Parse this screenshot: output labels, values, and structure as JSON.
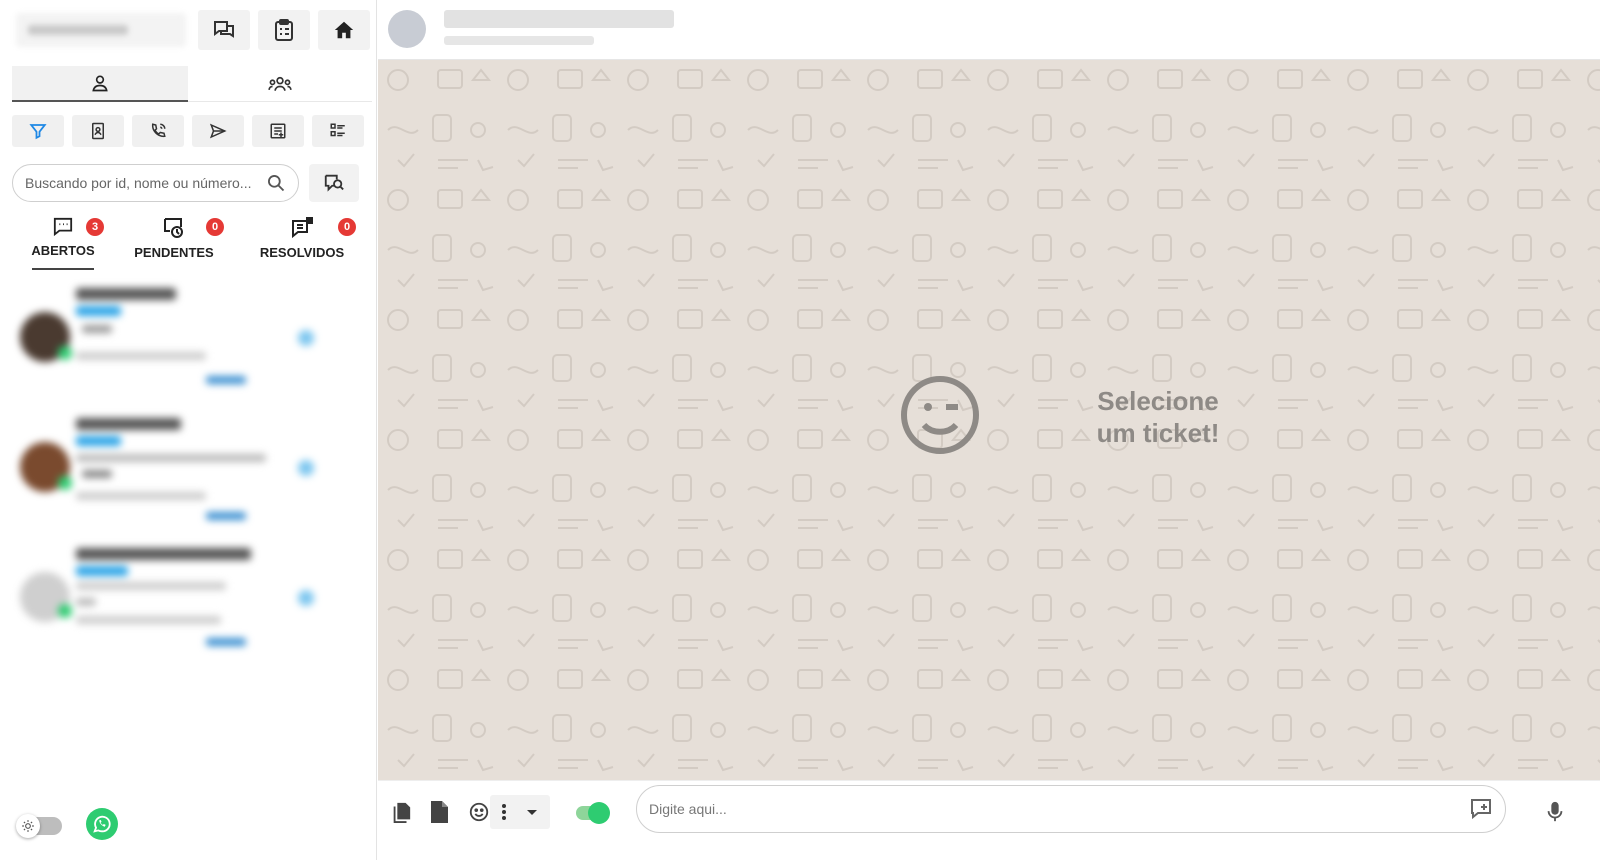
{
  "left": {
    "search": {
      "placeholder": "Buscando por id, nome ou número..."
    },
    "status_tabs": [
      {
        "label": "ABERTOS",
        "count": "3"
      },
      {
        "label": "PENDENTES",
        "count": "0"
      },
      {
        "label": "RESOLVIDOS",
        "count": "0"
      }
    ]
  },
  "chat": {
    "empty_line1": "Selecione",
    "empty_line2": "um ticket!"
  },
  "composer": {
    "placeholder": "Digite aqui..."
  },
  "colors": {
    "accent": "#2ecc71",
    "badge": "#e53935",
    "filter": "#1e88e5",
    "chat_bg": "#e6dfd8"
  }
}
